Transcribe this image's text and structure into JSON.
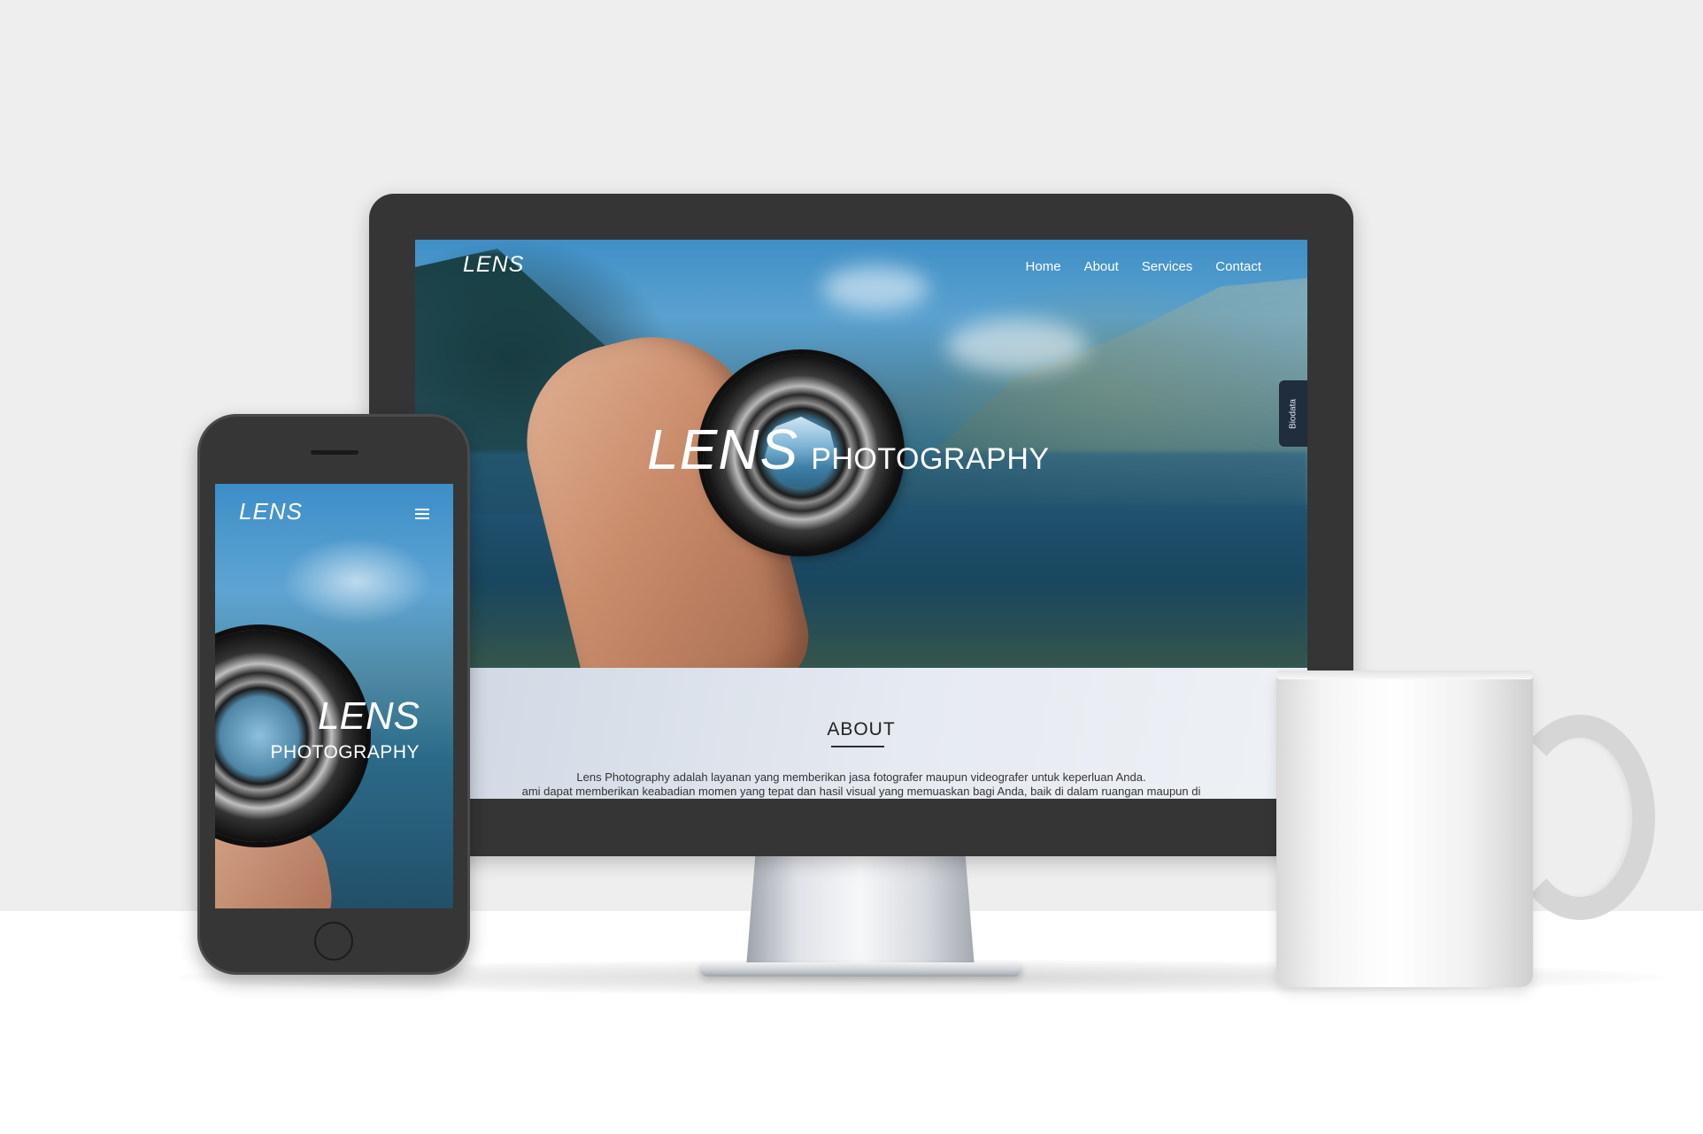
{
  "desktop": {
    "logo": "LENS",
    "nav": [
      "Home",
      "About",
      "Services",
      "Contact"
    ],
    "hero_title_big": "LENS",
    "hero_title_small": "PHOTOGRAPHY",
    "side_tab": "Biodata",
    "about": {
      "title": "ABOUT",
      "line1": "Lens Photography adalah layanan yang memberikan jasa fotografer maupun videografer untuk keperluan Anda.",
      "line2": "ami dapat memberikan keabadian momen yang tepat dan hasil visual yang memuaskan bagi Anda, baik di dalam ruangan maupun di"
    }
  },
  "mobile": {
    "logo": "LENS",
    "menu_icon": "hamburger-menu-icon",
    "hero_title_big": "LENS",
    "hero_title_small": "PHOTOGRAPHY"
  },
  "colors": {
    "device_frame": "#353535",
    "wall": "#eeeeee",
    "side_tab": "#1f2d3d"
  }
}
